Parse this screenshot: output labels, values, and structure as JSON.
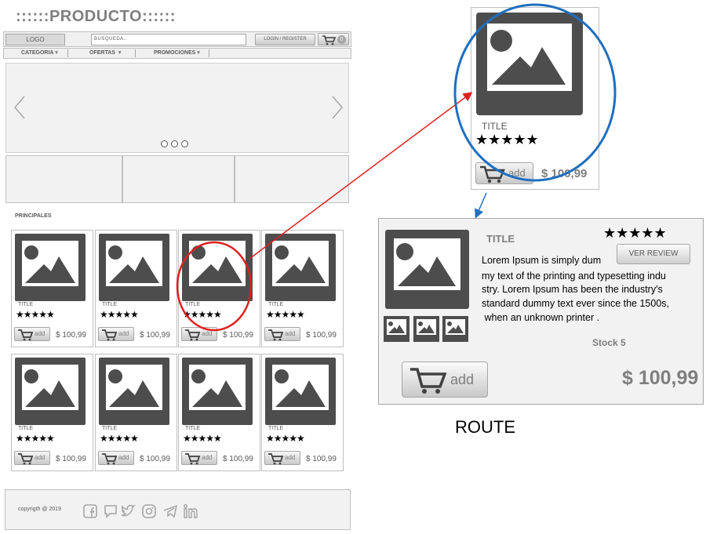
{
  "header": {
    "title": "::::::PRODUCTO::::::",
    "logo_label": "LOGO",
    "search_placeholder": "BUSQUEDA..",
    "login_label": "LOGIN / REGISTER",
    "cart_count": "0"
  },
  "nav": {
    "items": [
      {
        "label": "CATEGORIA"
      },
      {
        "label": "OFERTAS"
      },
      {
        "label": "PROMOCIONES"
      }
    ]
  },
  "section": {
    "label": "PRINCIPALES"
  },
  "products": [
    {
      "title": "TITLE",
      "stars": "★★★★★",
      "add_label": "add",
      "price": "$ 100,99"
    },
    {
      "title": "TITLE",
      "stars": "★★★★★",
      "add_label": "add",
      "price": "$ 100,99"
    },
    {
      "title": "TITLE",
      "stars": "★★★★★",
      "add_label": "add",
      "price": "$ 100,99"
    },
    {
      "title": "TITLE",
      "stars": "★★★★★",
      "add_label": "add",
      "price": "$ 100,99"
    },
    {
      "title": "TITLE",
      "stars": "★★★★★",
      "add_label": "add",
      "price": "$ 100,99"
    },
    {
      "title": "TITLE",
      "stars": "★★★★★",
      "add_label": "add",
      "price": "$ 100,99"
    },
    {
      "title": "TITLE",
      "stars": "★★★★★",
      "add_label": "add",
      "price": "$ 100,99"
    },
    {
      "title": "TITLE",
      "stars": "★★★★★",
      "add_label": "add",
      "price": "$ 100,99"
    }
  ],
  "footer": {
    "copyright": "copyrigth @ 2019",
    "social_icons": [
      "facebook-icon",
      "chat-icon",
      "twitter-icon",
      "instagram-icon",
      "telegram-icon",
      "linkedin-icon"
    ]
  },
  "zoom_card": {
    "title": "TITLE",
    "stars": "★★★★★",
    "add_label": "add",
    "price": "$ 100,99"
  },
  "detail": {
    "title": "TITLE",
    "stars": "★★★★★",
    "review_label": "VER REVIEW",
    "description_lines": [
      "Lorem Ipsum is simply dum",
      "my text of the printing and typesetting indu",
      "stry. Lorem Ipsum has been the industry's",
      "standard dummy text ever since the 1500s,",
      " when an unknown printer ."
    ],
    "stock": "Stock 5",
    "add_label": "add",
    "price": "$ 100,99"
  },
  "route_label": "ROUTE",
  "colors": {
    "highlight_red": "#e02020",
    "zoom_blue": "#1f6fbf",
    "image_gray": "#4d4d4d"
  }
}
